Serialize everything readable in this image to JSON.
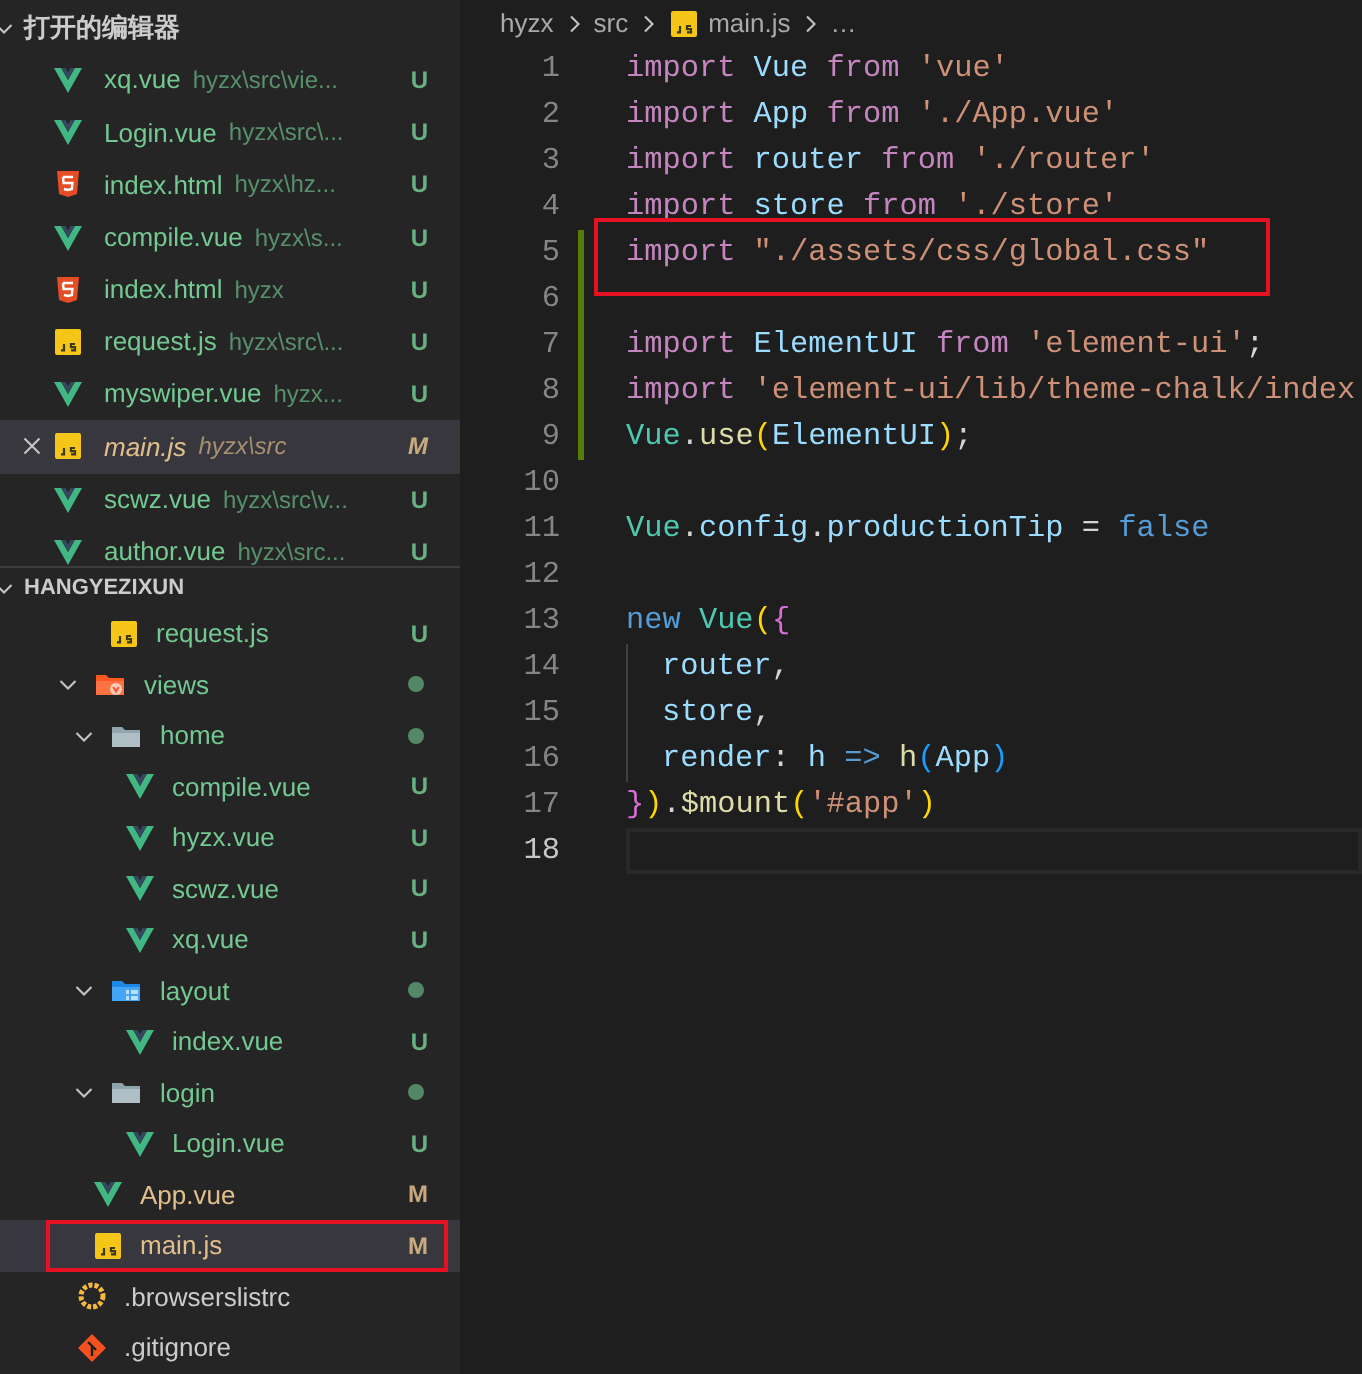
{
  "open_editors": {
    "title": "打开的编辑器",
    "items": [
      {
        "name": "xq.vue",
        "path": "hyzx\\src\\vie...",
        "status": "U",
        "color": "#73c991",
        "kind": "vue",
        "selected": false
      },
      {
        "name": "Login.vue",
        "path": "hyzx\\src\\...",
        "status": "U",
        "color": "#73c991",
        "kind": "vue",
        "selected": false
      },
      {
        "name": "index.html",
        "path": "hyzx\\hz...",
        "status": "U",
        "color": "#73c991",
        "kind": "html",
        "selected": false
      },
      {
        "name": "compile.vue",
        "path": "hyzx\\s...",
        "status": "U",
        "color": "#73c991",
        "kind": "vue",
        "selected": false
      },
      {
        "name": "index.html",
        "path": "hyzx",
        "status": "U",
        "color": "#73c991",
        "kind": "html",
        "selected": false
      },
      {
        "name": "request.js",
        "path": "hyzx\\src\\...",
        "status": "U",
        "color": "#73c991",
        "kind": "js",
        "selected": false
      },
      {
        "name": "myswiper.vue",
        "path": "hyzx...",
        "status": "U",
        "color": "#73c991",
        "kind": "vue",
        "selected": false
      },
      {
        "name": "main.js",
        "path": "hyzx\\src",
        "status": "M",
        "color": "#e2c08d",
        "kind": "js",
        "selected": true
      },
      {
        "name": "scwz.vue",
        "path": "hyzx\\src\\v...",
        "status": "U",
        "color": "#73c991",
        "kind": "vue",
        "selected": false
      },
      {
        "name": "author.vue",
        "path": "hyzx\\src...",
        "status": "U",
        "color": "#73c991",
        "kind": "vue",
        "selected": false
      }
    ]
  },
  "explorer": {
    "title": "HANGYEZIXUN",
    "tree": [
      {
        "children": [
          {
            "children": [
              {
                "name": "request.js",
                "kind": "js",
                "status": "U",
                "color": "#73c991",
                "selected": false,
                "annotated": false
              }
            ]
          },
          {
            "name": "views",
            "kind": "views-folder",
            "color": "#73c991",
            "expanded": true,
            "selected": false,
            "annotated": false,
            "children": [
              {
                "name": "home",
                "kind": "folder",
                "color": "#73c991",
                "expanded": true,
                "selected": false,
                "annotated": false,
                "children": [
                  {
                    "name": "compile.vue",
                    "kind": "vue",
                    "status": "U",
                    "color": "#73c991",
                    "selected": false,
                    "annotated": false
                  },
                  {
                    "name": "hyzx.vue",
                    "kind": "vue",
                    "status": "U",
                    "color": "#73c991",
                    "selected": false,
                    "annotated": false
                  },
                  {
                    "name": "scwz.vue",
                    "kind": "vue",
                    "status": "U",
                    "color": "#73c991",
                    "selected": false,
                    "annotated": false
                  },
                  {
                    "name": "xq.vue",
                    "kind": "vue",
                    "status": "U",
                    "color": "#73c991",
                    "selected": false,
                    "annotated": false
                  }
                ]
              },
              {
                "name": "layout",
                "kind": "layout-folder",
                "color": "#73c991",
                "expanded": true,
                "selected": false,
                "annotated": false,
                "children": [
                  {
                    "name": "index.vue",
                    "kind": "vue",
                    "status": "U",
                    "color": "#73c991",
                    "selected": false,
                    "annotated": false
                  }
                ]
              },
              {
                "name": "login",
                "kind": "folder",
                "color": "#73c991",
                "expanded": true,
                "selected": false,
                "annotated": false,
                "children": [
                  {
                    "name": "Login.vue",
                    "kind": "vue",
                    "status": "U",
                    "color": "#73c991",
                    "selected": false,
                    "annotated": false
                  }
                ]
              }
            ]
          },
          {
            "name": "App.vue",
            "kind": "vue",
            "status": "M",
            "color": "#e2c08d",
            "selected": false,
            "annotated": false
          },
          {
            "name": "main.js",
            "kind": "js",
            "status": "M",
            "color": "#e2c08d",
            "selected": true,
            "annotated": true
          }
        ]
      },
      {
        "name": ".browserslistrc",
        "kind": "browserslist",
        "selected": false,
        "annotated": false
      },
      {
        "name": ".gitignore",
        "kind": "git",
        "selected": false,
        "annotated": false
      }
    ]
  },
  "breadcrumb": [
    {
      "text": "hyzx",
      "kind": "folder"
    },
    {
      "text": "src",
      "kind": "folder"
    },
    {
      "text": "main.js",
      "kind": "js"
    },
    {
      "text": "…",
      "kind": "more"
    }
  ],
  "editor": {
    "lines": [
      {
        "number": "1",
        "changed": false,
        "current": false,
        "annotated": false,
        "indent_guide": false,
        "tokens": [
          {
            "kind": "keyword",
            "t": "import"
          },
          {
            "kind": "variable",
            "t": " Vue"
          },
          {
            "kind": "keyword",
            "t": " from"
          },
          {
            "kind": "string",
            "t": " 'vue'"
          }
        ]
      },
      {
        "number": "2",
        "changed": false,
        "current": false,
        "annotated": false,
        "indent_guide": false,
        "tokens": [
          {
            "kind": "keyword",
            "t": "import"
          },
          {
            "kind": "variable",
            "t": " App"
          },
          {
            "kind": "keyword",
            "t": " from"
          },
          {
            "kind": "string",
            "t": " './App.vue'"
          }
        ]
      },
      {
        "number": "3",
        "changed": false,
        "current": false,
        "annotated": false,
        "indent_guide": false,
        "tokens": [
          {
            "kind": "keyword",
            "t": "import"
          },
          {
            "kind": "variable",
            "t": " router"
          },
          {
            "kind": "keyword",
            "t": " from"
          },
          {
            "kind": "string",
            "t": " './router'"
          }
        ]
      },
      {
        "number": "4",
        "changed": false,
        "current": false,
        "annotated": false,
        "indent_guide": false,
        "tokens": [
          {
            "kind": "keyword",
            "t": "import"
          },
          {
            "kind": "variable",
            "t": " store"
          },
          {
            "kind": "keyword",
            "t": " from"
          },
          {
            "kind": "string",
            "t": " './store'"
          }
        ]
      },
      {
        "number": "5",
        "changed": true,
        "current": false,
        "annotated": true,
        "indent_guide": false,
        "tokens": [
          {
            "kind": "keyword",
            "t": "import"
          },
          {
            "kind": "string",
            "t": " \"./assets/css/global.css\""
          }
        ]
      },
      {
        "number": "6",
        "changed": true,
        "current": false,
        "annotated": false,
        "indent_guide": false
      },
      {
        "number": "7",
        "changed": true,
        "current": false,
        "annotated": false,
        "indent_guide": false,
        "tokens": [
          {
            "kind": "keyword",
            "t": "import"
          },
          {
            "kind": "variable",
            "t": " ElementUI"
          },
          {
            "kind": "keyword",
            "t": " from"
          },
          {
            "kind": "string",
            "t": " 'element-ui'"
          },
          {
            "kind": "plain",
            "t": ";"
          }
        ]
      },
      {
        "number": "8",
        "changed": true,
        "current": false,
        "annotated": false,
        "indent_guide": false,
        "tokens": [
          {
            "kind": "keyword",
            "t": "import"
          },
          {
            "kind": "string",
            "t": " 'element-ui/lib/theme-chalk/index"
          }
        ]
      },
      {
        "number": "9",
        "changed": true,
        "current": false,
        "annotated": false,
        "indent_guide": false,
        "tokens": [
          {
            "kind": "class",
            "t": "Vue"
          },
          {
            "kind": "plain",
            "t": "."
          },
          {
            "kind": "function",
            "t": "use"
          },
          {
            "kind": "bracket1",
            "t": "("
          },
          {
            "kind": "variable",
            "t": "ElementUI"
          },
          {
            "kind": "bracket1",
            "t": ")"
          },
          {
            "kind": "plain",
            "t": ";"
          }
        ]
      },
      {
        "number": "10",
        "changed": false,
        "current": false,
        "annotated": false,
        "indent_guide": false
      },
      {
        "number": "11",
        "changed": false,
        "current": false,
        "annotated": false,
        "indent_guide": false,
        "tokens": [
          {
            "kind": "class",
            "t": "Vue"
          },
          {
            "kind": "plain",
            "t": "."
          },
          {
            "kind": "variable",
            "t": "config"
          },
          {
            "kind": "plain",
            "t": "."
          },
          {
            "kind": "variable",
            "t": "productionTip"
          },
          {
            "kind": "plain",
            "t": " = "
          },
          {
            "kind": "storage",
            "t": "false"
          }
        ]
      },
      {
        "number": "12",
        "changed": false,
        "current": false,
        "annotated": false,
        "indent_guide": false
      },
      {
        "number": "13",
        "changed": false,
        "current": false,
        "annotated": false,
        "indent_guide": false,
        "tokens": [
          {
            "kind": "storage",
            "t": "new"
          },
          {
            "kind": "class",
            "t": " Vue"
          },
          {
            "kind": "bracket1",
            "t": "("
          },
          {
            "kind": "bracket2",
            "t": "{"
          }
        ]
      },
      {
        "number": "14",
        "changed": false,
        "current": false,
        "annotated": false,
        "indent_guide": true,
        "tokens": [
          {
            "kind": "variable",
            "t": "router"
          },
          {
            "kind": "plain",
            "t": ","
          }
        ]
      },
      {
        "number": "15",
        "changed": false,
        "current": false,
        "annotated": false,
        "indent_guide": true,
        "tokens": [
          {
            "kind": "variable",
            "t": "store"
          },
          {
            "kind": "plain",
            "t": ","
          }
        ]
      },
      {
        "number": "16",
        "changed": false,
        "current": false,
        "annotated": false,
        "indent_guide": true,
        "tokens": [
          {
            "kind": "variable",
            "t": "render"
          },
          {
            "kind": "plain",
            "t": ": "
          },
          {
            "kind": "variable",
            "t": "h"
          },
          {
            "kind": "storage",
            "t": " => "
          },
          {
            "kind": "function",
            "t": "h"
          },
          {
            "kind": "bracket3",
            "t": "("
          },
          {
            "kind": "variable",
            "t": "App"
          },
          {
            "kind": "bracket3",
            "t": ")"
          }
        ]
      },
      {
        "number": "17",
        "changed": false,
        "current": false,
        "annotated": false,
        "indent_guide": false,
        "tokens": [
          {
            "kind": "bracket2",
            "t": "}"
          },
          {
            "kind": "bracket1",
            "t": ")"
          },
          {
            "kind": "plain",
            "t": "."
          },
          {
            "kind": "function",
            "t": "$mount"
          },
          {
            "kind": "bracket1",
            "t": "("
          },
          {
            "kind": "string",
            "t": "'#app'"
          },
          {
            "kind": "bracket1",
            "t": ")"
          }
        ]
      },
      {
        "number": "18",
        "changed": false,
        "current": true,
        "annotated": false,
        "indent_guide": false
      }
    ]
  }
}
